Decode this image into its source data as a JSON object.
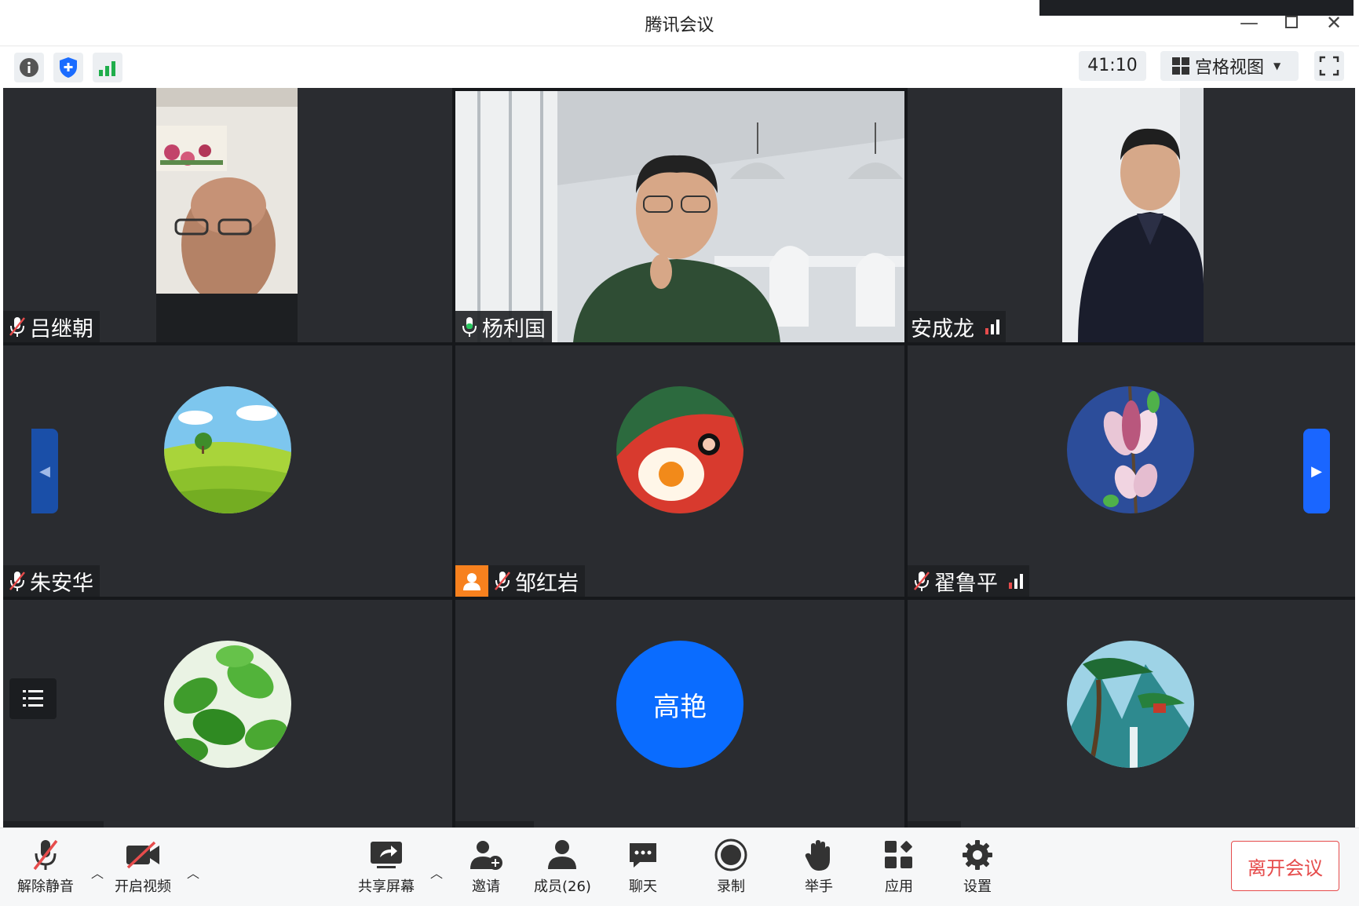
{
  "window": {
    "title": "腾讯会议"
  },
  "infobar": {
    "timer": "41:10",
    "view_label": "宫格视图"
  },
  "participants": [
    {
      "name": "吕继朝",
      "muted": true,
      "video": true
    },
    {
      "name": "杨利国",
      "muted": false,
      "video": true,
      "speaking": true
    },
    {
      "name": "安成龙",
      "muted": null,
      "video": true
    },
    {
      "name": "朱安华",
      "muted": true,
      "avatar": "farm-field-icon"
    },
    {
      "name": "邹红岩",
      "muted": true,
      "host": true,
      "avatar": "fried-egg-icon"
    },
    {
      "name": "翟鲁平",
      "muted": true,
      "avatar": "magnolia-flower-icon"
    },
    {
      "name": "",
      "avatar": "green-leaves-icon"
    },
    {
      "name": "",
      "avatar_text": "高艳"
    },
    {
      "name": "",
      "avatar": "mountain-pine-icon"
    }
  ],
  "bottombar": {
    "unmute": "解除静音",
    "start_video": "开启视频",
    "share_screen": "共享屏幕",
    "invite": "邀请",
    "members": "成员(26)",
    "chat": "聊天",
    "record": "录制",
    "raise_hand": "举手",
    "apps": "应用",
    "settings": "设置",
    "leave": "离开会议"
  },
  "colors": {
    "accent": "#0a6cff",
    "active_speaker": "#23c25a",
    "leave": "#e64c4c",
    "host_badge": "#f7811e"
  }
}
